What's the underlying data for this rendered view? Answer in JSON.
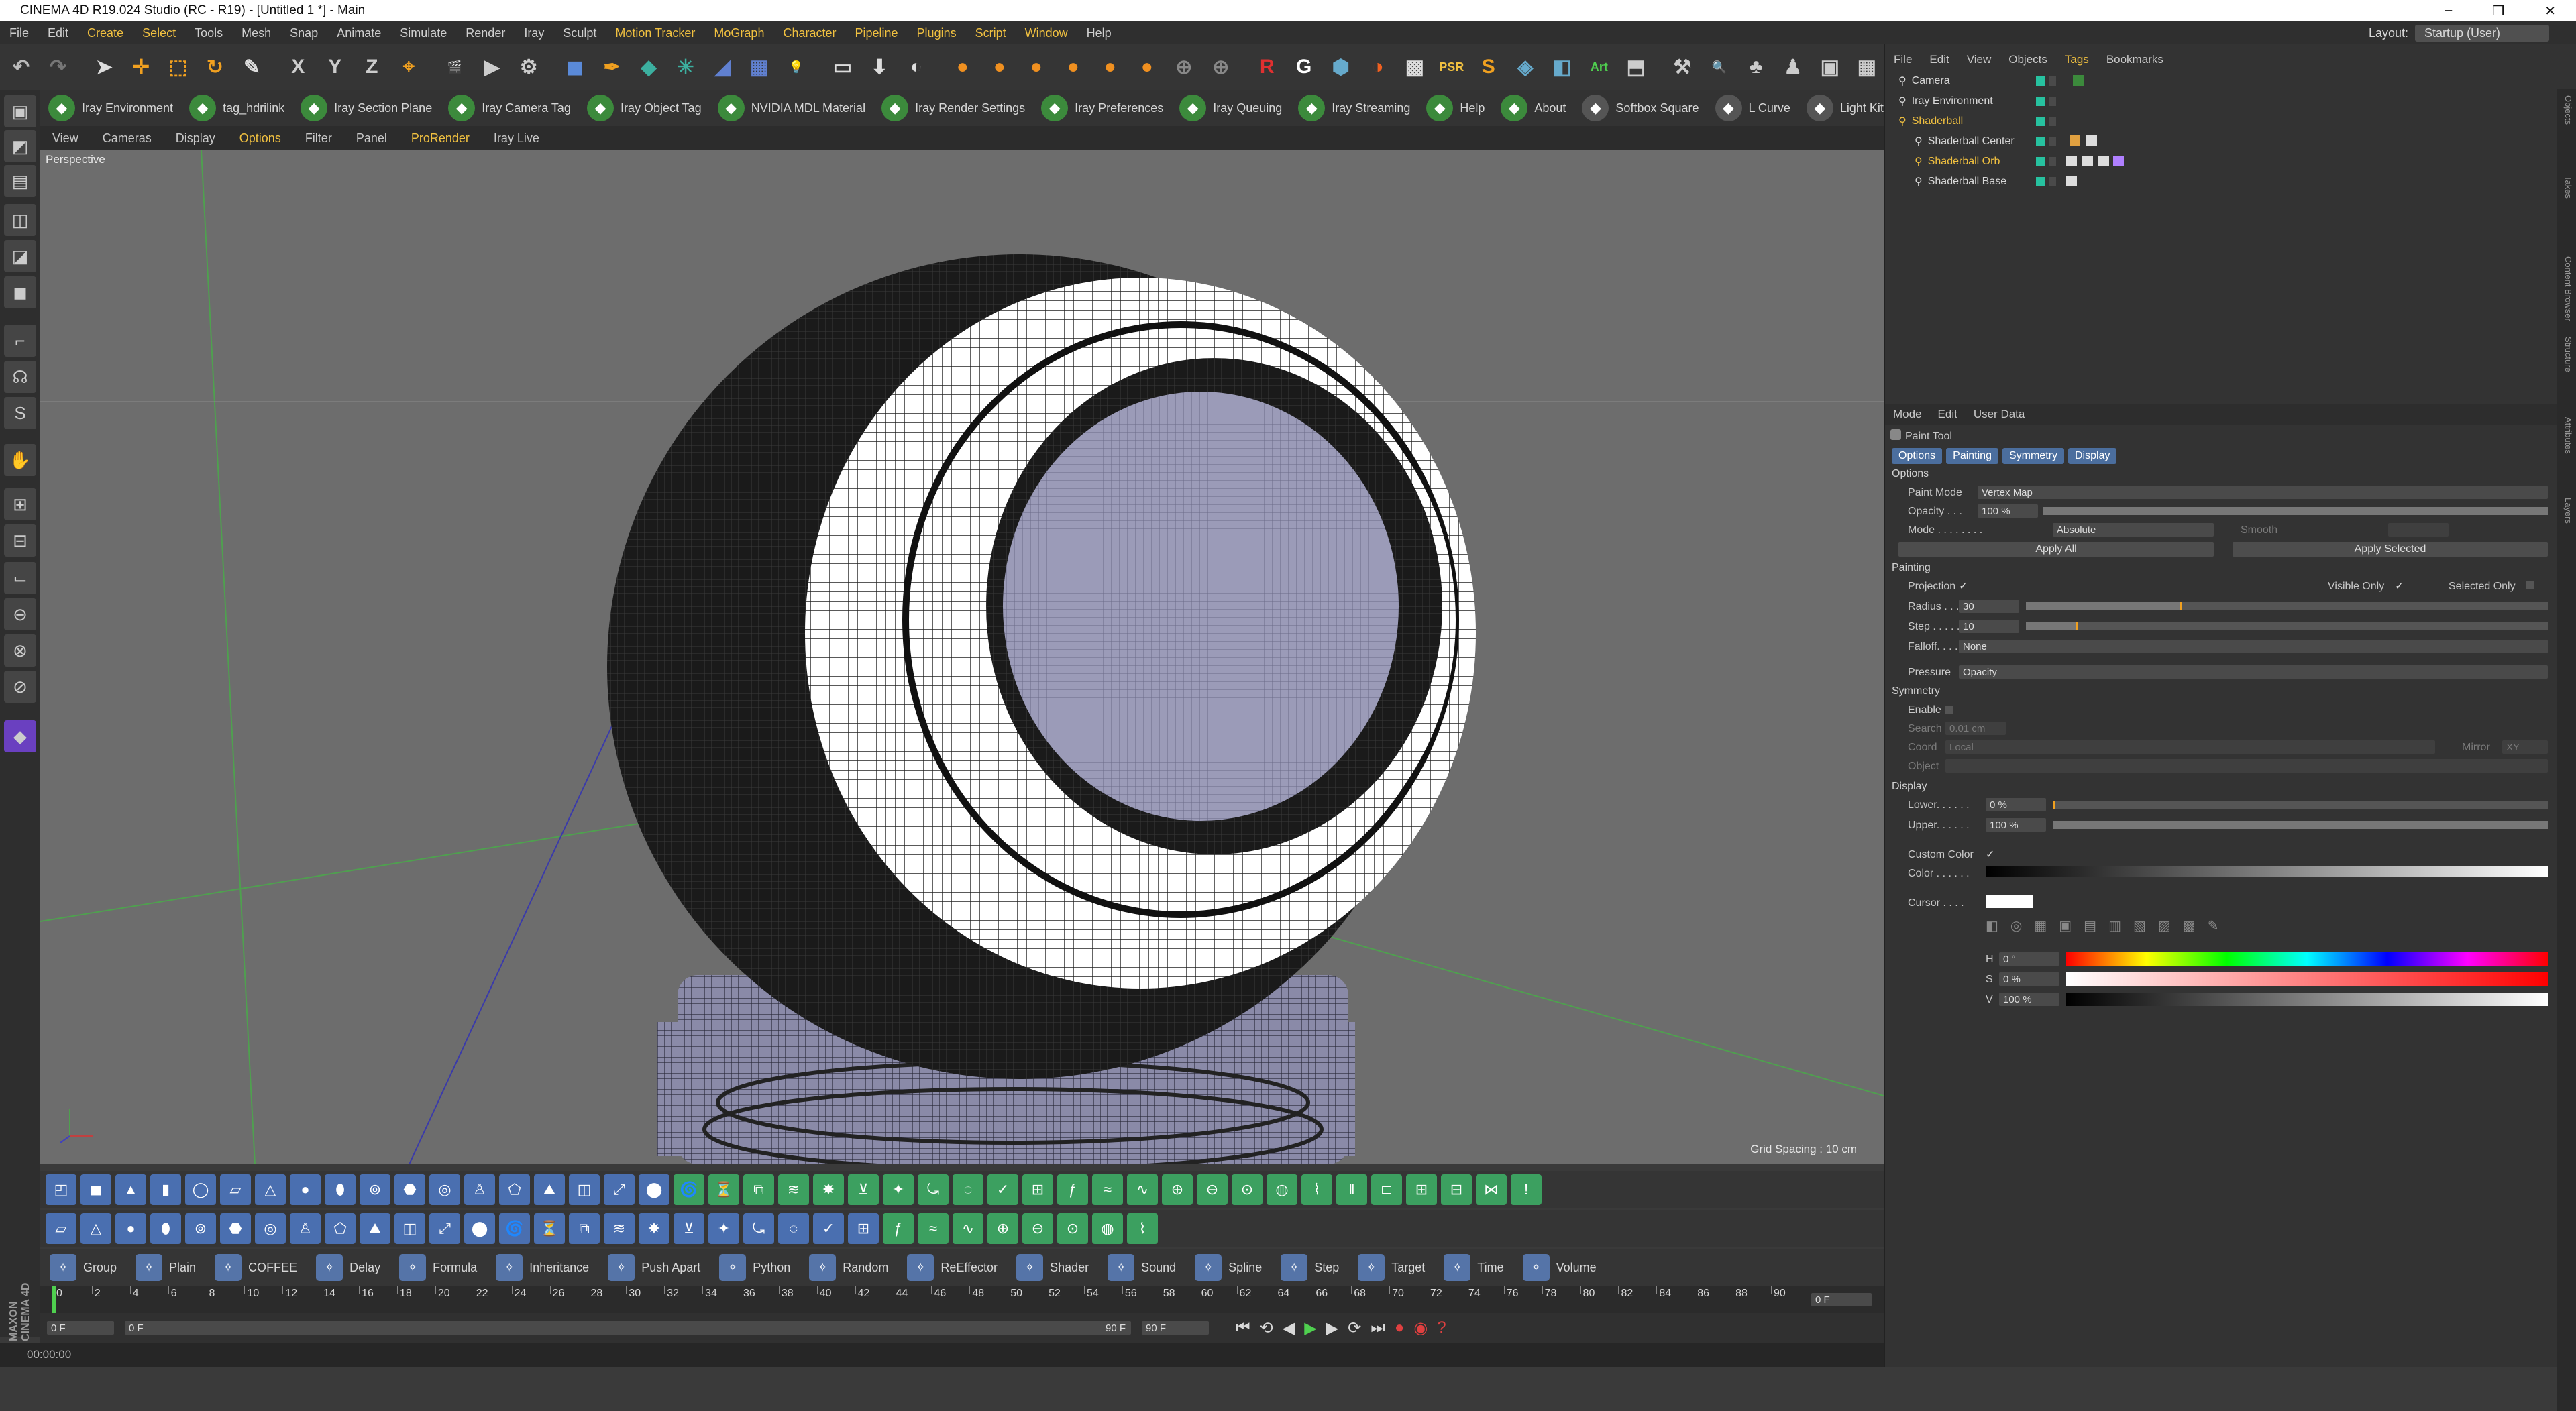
{
  "window": {
    "title": "CINEMA 4D R19.024 Studio (RC - R19) - [Untitled 1 *] - Main",
    "minimize": "–",
    "restore": "❐",
    "close": "✕"
  },
  "menubar": {
    "items": [
      "File",
      "Edit",
      "Create",
      "Select",
      "Tools",
      "Mesh",
      "Snap",
      "Animate",
      "Simulate",
      "Render",
      "Iray",
      "Sculpt",
      "Motion Tracker",
      "MoGraph",
      "Character",
      "Pipeline",
      "Plugins",
      "Script",
      "Window",
      "Help"
    ],
    "layout_label": "Layout:",
    "layout_value": "Startup (User)"
  },
  "plugins_bar": {
    "items": [
      "Iray Environment",
      "tag_hdrilink",
      "Iray Section Plane",
      "Iray Camera Tag",
      "Iray Object Tag",
      "NVIDIA MDL Material",
      "Iray Render Settings",
      "Iray Preferences",
      "Iray Queuing",
      "Iray Streaming",
      "Help",
      "About",
      "Softbox Square",
      "L Curve",
      "Light Kit Browser"
    ]
  },
  "viewport_menu": {
    "items": [
      "View",
      "Cameras",
      "Display",
      "Options",
      "Filter",
      "Panel",
      "ProRender",
      "Iray Live"
    ]
  },
  "viewport": {
    "label": "Perspective",
    "grid_spacing": "Grid Spacing : 10 cm"
  },
  "bottom_toolbar": {
    "items": [
      "Group",
      "Plain",
      "COFFEE",
      "Delay",
      "Formula",
      "Inheritance",
      "Push Apart",
      "Python",
      "Random",
      "ReEffector",
      "Shader",
      "Sound",
      "Spline",
      "Step",
      "Target",
      "Time",
      "Volume"
    ]
  },
  "timeline": {
    "ticks": [
      "0",
      "2",
      "4",
      "6",
      "8",
      "10",
      "12",
      "14",
      "16",
      "18",
      "20",
      "22",
      "24",
      "26",
      "28",
      "30",
      "32",
      "34",
      "36",
      "38",
      "40",
      "42",
      "44",
      "46",
      "48",
      "50",
      "52",
      "54",
      "56",
      "58",
      "60",
      "62",
      "64",
      "66",
      "68",
      "70",
      "72",
      "74",
      "76",
      "78",
      "80",
      "82",
      "84",
      "86",
      "88",
      "90"
    ],
    "current_frame": "0 F",
    "start": "0 F",
    "range_start": "0 F",
    "range_end": "90 F",
    "end": "90 F"
  },
  "status": {
    "time": "00:00:00"
  },
  "maxon": "MAXON CINEMA 4D",
  "object_manager": {
    "menu": [
      "File",
      "Edit",
      "View",
      "Objects",
      "Tags",
      "Bookmarks"
    ],
    "objects": [
      {
        "name": "Camera",
        "indent": 0,
        "selected": false
      },
      {
        "name": "Iray Environment",
        "indent": 0,
        "selected": false
      },
      {
        "name": "Shaderball",
        "indent": 0,
        "selected": true
      },
      {
        "name": "Shaderball Center",
        "indent": 1,
        "selected": false
      },
      {
        "name": "Shaderball Orb",
        "indent": 1,
        "selected": true
      },
      {
        "name": "Shaderball Base",
        "indent": 1,
        "selected": false
      }
    ]
  },
  "attribute_manager": {
    "menu": [
      "Mode",
      "Edit",
      "User Data"
    ],
    "tool": "Paint Tool",
    "tabs": [
      "Options",
      "Painting",
      "Symmetry",
      "Display"
    ],
    "options": {
      "section": "Options",
      "paint_mode_label": "Paint Mode",
      "paint_mode": "Vertex Map",
      "opacity_label": "Opacity . . .",
      "opacity": "100 %",
      "opacity_fraction": 1.0,
      "mode_label": "Mode . . . . . . . .",
      "mode": "Absolute",
      "smooth_label": "Smooth",
      "apply_all": "Apply All",
      "apply_selected": "Apply Selected"
    },
    "painting": {
      "section": "Painting",
      "projection_label": "Projection",
      "visible_only_label": "Visible Only",
      "selected_only_label": "Selected Only",
      "radius_label": "Radius . . .",
      "radius": "30",
      "radius_fraction": 0.3,
      "step_label": "Step . . . . .",
      "step": "10",
      "step_fraction": 0.1,
      "falloff_label": "Falloff. . . .",
      "falloff": "None",
      "pressure_label": "Pressure",
      "pressure": "Opacity"
    },
    "symmetry": {
      "section": "Symmetry",
      "enable_label": "Enable",
      "search_label": "Search",
      "search": "0.01 cm",
      "coord_label": "Coord",
      "coord": "Local",
      "mirror_label": "Mirror",
      "mirror": "XY",
      "object_label": "Object"
    },
    "display": {
      "section": "Display",
      "lower_label": "Lower. . . . . .",
      "lower": "0 %",
      "upper_label": "Upper. . . . . .",
      "upper": "100 %",
      "upper_fraction": 1.0,
      "custom_color_label": "Custom Color",
      "color_label": "Color . . . . . .",
      "cursor_label": "Cursor . . . .",
      "h_label": "H",
      "h": "0 °",
      "s_label": "S",
      "s": "0 %",
      "v_label": "V",
      "v": "100 %"
    }
  },
  "side_tabs": [
    "Objects",
    "Takes",
    "Content Browser",
    "Structure",
    "Attributes",
    "Layers"
  ],
  "colors": {
    "accent": "#f0c040",
    "iray_green": "#3c8a3c",
    "tab_blue": "#4b6e9e"
  }
}
